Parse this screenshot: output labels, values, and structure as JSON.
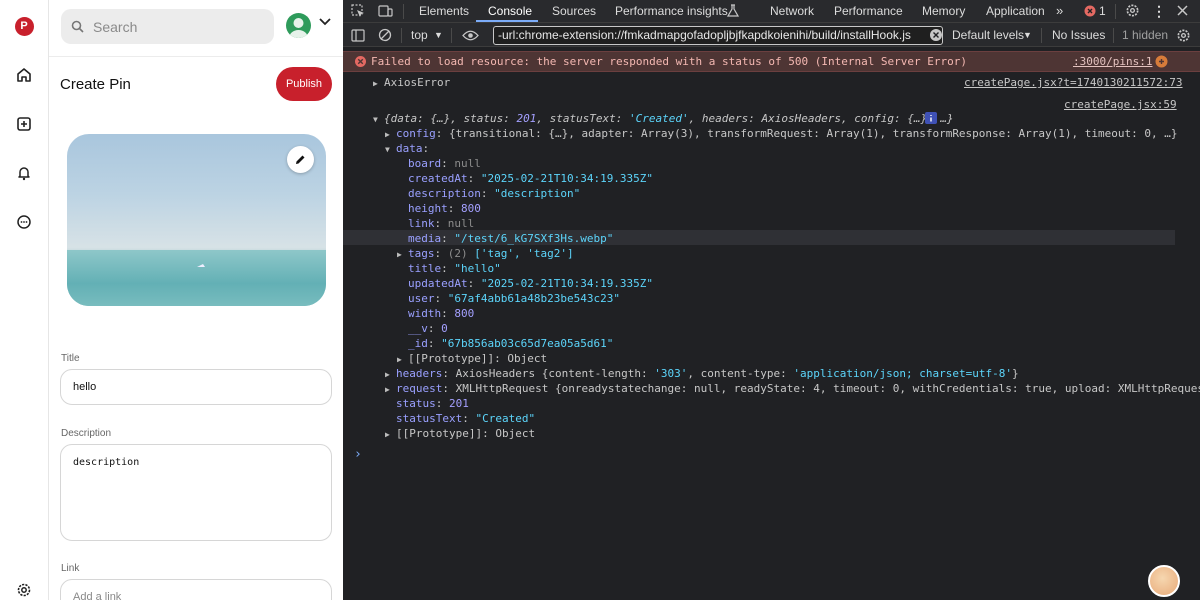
{
  "app": {
    "logo_letter": "P",
    "search_placeholder": "Search",
    "page_title": "Create Pin",
    "publish_label": "Publish",
    "fields": {
      "title_label": "Title",
      "title_value": "hello",
      "description_label": "Description",
      "description_value": "description",
      "link_label": "Link",
      "link_placeholder": "Add a link"
    },
    "rail_icons": [
      "logo-icon",
      "home-icon",
      "plus-square-icon",
      "bell-icon",
      "chat-icon",
      "settings-icon"
    ],
    "brand_color": "#c8202c"
  },
  "devtools": {
    "tabs": [
      "Elements",
      "Console",
      "Sources",
      "Performance insights",
      "Network",
      "Performance",
      "Memory",
      "Application"
    ],
    "active_tab": "Console",
    "error_count": "1",
    "context": "top",
    "filter_value": "-url:chrome-extension://fmkadmapgofadopljbjfkapdkoienihi/build/installHook.js",
    "levels": "Default levels",
    "issues": "No Issues",
    "hidden": "1 hidden",
    "error_line": {
      "text": "Failed to load resource: the server responded with a status of 500 (Internal Server Error)",
      "source": ":3000/pins:1"
    },
    "axios_error": {
      "text": "AxiosError",
      "source": "createPage.jsx?t=1740130211572:73"
    },
    "log_source": "createPage.jsx:59",
    "summary": {
      "open": "{data: {…}, status: ",
      "status": "201",
      "mid": ", statusText: ",
      "statusText": "'Created'",
      "rest": ", headers: AxiosHeaders, config: {…}, …}"
    },
    "config_line": "{transitional: {…}, adapter: Array(3), transformRequest: Array(1), transformResponse: Array(1), timeout: 0, …}",
    "data": {
      "board": "null",
      "createdAt": "\"2025-02-21T10:34:19.335Z\"",
      "description": "\"description\"",
      "height": "800",
      "link": "null",
      "media": "\"/test/6_kG7SXf3Hs.webp\"",
      "tags_count": "(2)",
      "tags": "['tag', 'tag2']",
      "title": "\"hello\"",
      "updatedAt": "\"2025-02-21T10:34:19.335Z\"",
      "user": "\"67af4abb61a48b23be543c23\"",
      "width": "800",
      "__v": "0",
      "_id": "\"67b856ab03c65d7ea05a5d61\""
    },
    "prototype": "[[Prototype]]: Object",
    "headers_line": {
      "type": "AxiosHeaders ",
      "body_pre": "{content-length: ",
      "len": "'303'",
      "body_mid": ", content-type: ",
      "ctype": "'application/json; charset=utf-8'",
      "body_end": "}"
    },
    "request_line": "XMLHttpRequest {onreadystatechange: null, readyState: 4, timeout: 0, withCredentials: true, upload: XMLHttpRequestUpl",
    "status": "201",
    "statusText": "\"Created\"",
    "key_labels": {
      "config": "config",
      "data": "data",
      "headers": "headers",
      "request": "request",
      "status": "status",
      "statusText": "statusText",
      "board": "board",
      "createdAt": "createdAt",
      "description": "description",
      "height": "height",
      "link": "link",
      "media": "media",
      "tags": "tags",
      "title": "title",
      "updatedAt": "updatedAt",
      "user": "user",
      "width": "width",
      "__v": "__v",
      "_id": "_id"
    }
  }
}
